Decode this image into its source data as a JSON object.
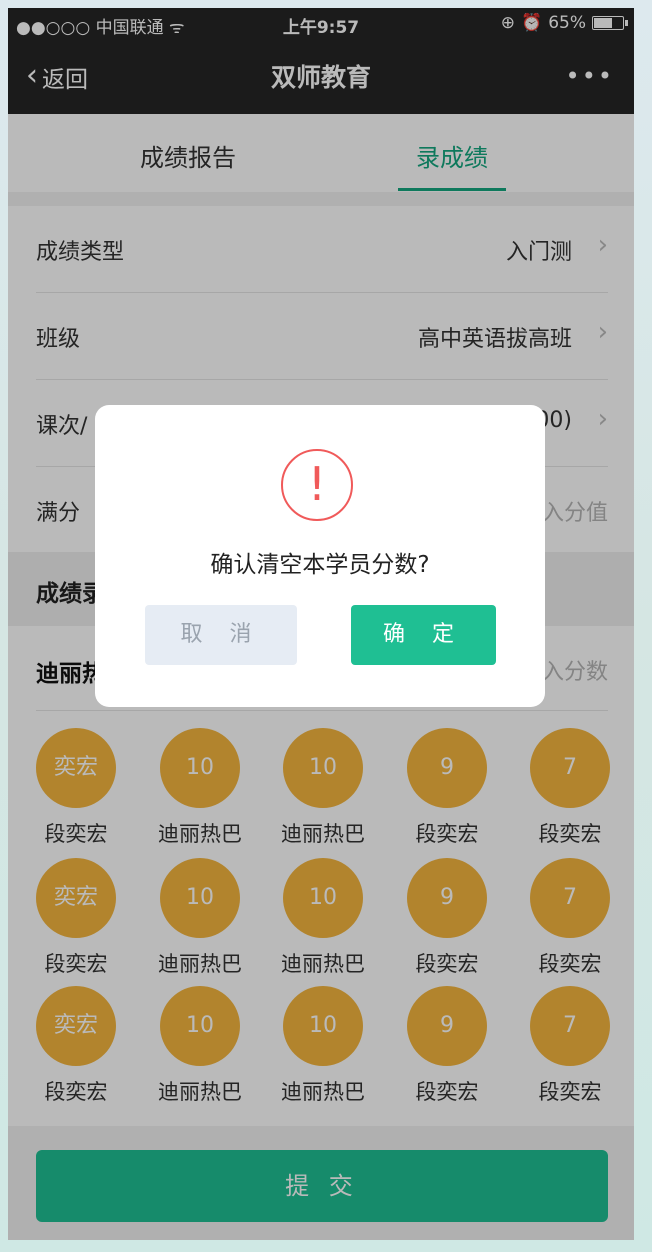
{
  "status_bar": {
    "carrier": "●●○○○ 中国联通 ᯤ",
    "time": "上午9:57",
    "battery": "65%",
    "battery_level": 0.65,
    "icons": [
      "lock-rotation-icon",
      "alarm-icon"
    ]
  },
  "nav": {
    "back_label": "返回",
    "title": "双师教育",
    "more": "•••"
  },
  "tabs": [
    {
      "label": "成绩报告",
      "active": false
    },
    {
      "label": "录成绩",
      "active": true
    }
  ],
  "form": {
    "rows": [
      {
        "label": "成绩类型",
        "value": "入门测"
      },
      {
        "label": "班级",
        "value": "高中英语拔高班"
      },
      {
        "label": "课次/",
        "value": "00)"
      },
      {
        "label": "满分",
        "value": "入分值"
      }
    ]
  },
  "section": {
    "label": "成绩录"
  },
  "student": {
    "name": "迪丽热",
    "input_placeholder": "入分数"
  },
  "score_grid": [
    [
      {
        "score": "奕宏",
        "name": "段奕宏"
      },
      {
        "score": "10",
        "name": "迪丽热巴"
      },
      {
        "score": "10",
        "name": "迪丽热巴"
      },
      {
        "score": "9",
        "name": "段奕宏"
      },
      {
        "score": "7",
        "name": "段奕宏"
      }
    ],
    [
      {
        "score": "奕宏",
        "name": "段奕宏"
      },
      {
        "score": "10",
        "name": "迪丽热巴"
      },
      {
        "score": "10",
        "name": "迪丽热巴"
      },
      {
        "score": "9",
        "name": "段奕宏"
      },
      {
        "score": "7",
        "name": "段奕宏"
      }
    ],
    [
      {
        "score": "奕宏",
        "name": "段奕宏"
      },
      {
        "score": "10",
        "name": "迪丽热巴"
      },
      {
        "score": "10",
        "name": "迪丽热巴"
      },
      {
        "score": "9",
        "name": "段奕宏"
      },
      {
        "score": "7",
        "name": "段奕宏"
      }
    ]
  ],
  "submit_label": "提 交",
  "dialog": {
    "icon_glyph": "!",
    "message": "确认清空本学员分数?",
    "cancel_label": "取 消",
    "confirm_label": "确 定"
  },
  "colors": {
    "accent": "#1fbf93",
    "tab_active": "#14a67f",
    "score_circle": "#f4b63e",
    "warning": "#f05a5a",
    "nav_bg": "#262626"
  }
}
